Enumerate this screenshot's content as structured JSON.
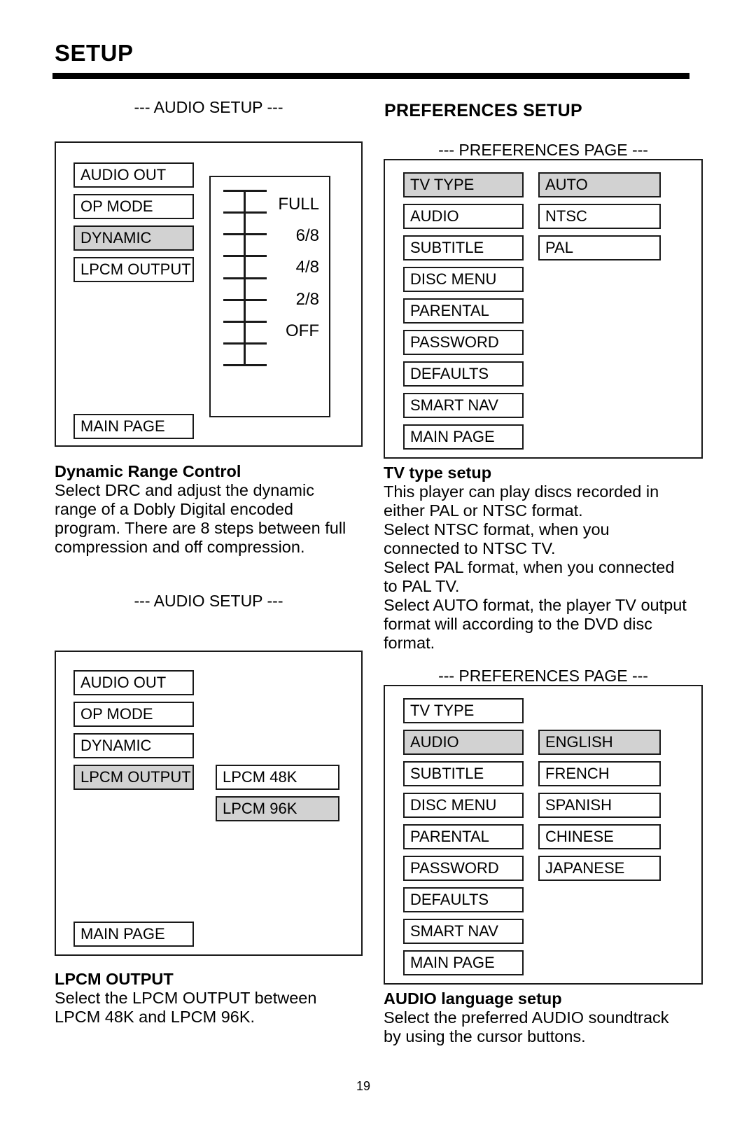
{
  "header": {
    "title": "SETUP",
    "page_number": "19"
  },
  "left_column": {
    "audio_setup_caption_1": "--- AUDIO SETUP ---",
    "audio_setup_caption_2": "--- AUDIO SETUP ---",
    "audio_menu_1": [
      {
        "label": "AUDIO OUT",
        "selected": false
      },
      {
        "label": "OP MODE",
        "selected": false
      },
      {
        "label": "DYNAMIC",
        "selected": true
      },
      {
        "label": "LPCM OUTPUT",
        "selected": false
      }
    ],
    "audio_menu_1_main_page": {
      "label": "MAIN PAGE",
      "selected": false
    },
    "drc_slider": {
      "tick_count": 9,
      "labels": [
        "FULL",
        "6/8",
        "4/8",
        "2/8",
        "OFF"
      ]
    },
    "drc_text": {
      "heading": "Dynamic Range Control",
      "lines": [
        "Select DRC and adjust the dynamic",
        "range of a Dobly Digital encoded",
        "program.  There are 8 steps between full",
        "compression and off compression."
      ]
    },
    "audio_menu_2": [
      {
        "label": "AUDIO OUT",
        "selected": false
      },
      {
        "label": "OP MODE",
        "selected": false
      },
      {
        "label": "DYNAMIC",
        "selected": false
      },
      {
        "label": "LPCM OUTPUT",
        "selected": true
      }
    ],
    "lpcm_options": [
      {
        "label": "LPCM 48K",
        "selected": false
      },
      {
        "label": "LPCM 96K",
        "selected": true
      }
    ],
    "audio_menu_2_main_page": {
      "label": "MAIN PAGE",
      "selected": false
    },
    "lpcm_text": {
      "heading": "LPCM OUTPUT",
      "lines": [
        "Select the LPCM OUTPUT between",
        "LPCM 48K and LPCM 96K."
      ]
    }
  },
  "right_column": {
    "section_heading": "PREFERENCES SETUP",
    "prefs_caption_1": "--- PREFERENCES PAGE ---",
    "prefs_caption_2": "--- PREFERENCES PAGE ---",
    "prefs_menu_1": [
      {
        "label": "TV TYPE",
        "selected": true
      },
      {
        "label": "AUDIO",
        "selected": false
      },
      {
        "label": "SUBTITLE",
        "selected": false
      },
      {
        "label": "DISC MENU",
        "selected": false
      },
      {
        "label": "PARENTAL",
        "selected": false
      },
      {
        "label": "PASSWORD",
        "selected": false
      },
      {
        "label": "DEFAULTS",
        "selected": false
      },
      {
        "label": "SMART NAV",
        "selected": false
      },
      {
        "label": "MAIN PAGE",
        "selected": false
      }
    ],
    "tvtype_options": [
      {
        "label": "AUTO",
        "selected": true
      },
      {
        "label": "NTSC",
        "selected": false
      },
      {
        "label": "PAL",
        "selected": false
      }
    ],
    "tvtype_text": {
      "heading": "TV type setup",
      "lines": [
        "This player can play discs recorded in",
        "either PAL or NTSC format.",
        "Select NTSC format, when you",
        "connected to NTSC TV.",
        "Select PAL format, when you connected",
        "to PAL TV.",
        "Select AUTO format, the player TV output",
        "format will according to the DVD disc",
        "format."
      ]
    },
    "prefs_menu_2": [
      {
        "label": "TV TYPE",
        "selected": false
      },
      {
        "label": "AUDIO",
        "selected": true
      },
      {
        "label": "SUBTITLE",
        "selected": false
      },
      {
        "label": "DISC MENU",
        "selected": false
      },
      {
        "label": "PARENTAL",
        "selected": false
      },
      {
        "label": "PASSWORD",
        "selected": false
      },
      {
        "label": "DEFAULTS",
        "selected": false
      },
      {
        "label": "SMART NAV",
        "selected": false
      },
      {
        "label": "MAIN PAGE",
        "selected": false
      }
    ],
    "audio_lang_options": [
      {
        "label": "ENGLISH",
        "selected": true
      },
      {
        "label": "FRENCH",
        "selected": false
      },
      {
        "label": "SPANISH",
        "selected": false
      },
      {
        "label": "CHINESE",
        "selected": false
      },
      {
        "label": "JAPANESE",
        "selected": false
      }
    ],
    "audio_lang_text": {
      "heading": "AUDIO language setup",
      "lines": [
        "Select the preferred AUDIO soundtrack",
        "by using the cursor buttons."
      ]
    }
  },
  "colors": {
    "selected_fill": "#d2d2d2",
    "line": "#1a1a1a"
  }
}
